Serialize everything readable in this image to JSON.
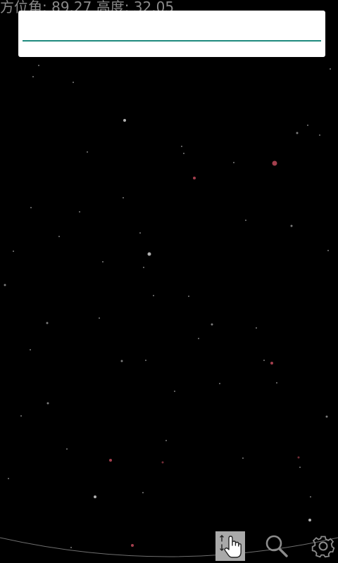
{
  "status": {
    "coordinates_text": "方位角: 89.27 高度: 32.05"
  },
  "search": {
    "value": "",
    "placeholder": ""
  },
  "toolbar": {
    "buttons": [
      {
        "icon": "hand-pointer-scroll-icon",
        "active": true
      },
      {
        "icon": "search-icon",
        "active": false
      },
      {
        "icon": "gear-icon",
        "active": false
      }
    ]
  },
  "colors": {
    "background": "#000000",
    "accent": "#1e8a7e",
    "coordinates_text": "#8a8a8a",
    "star_white": "#cfcfcf",
    "star_red": "#c04a5a",
    "active_button": "#a9a9a9"
  }
}
